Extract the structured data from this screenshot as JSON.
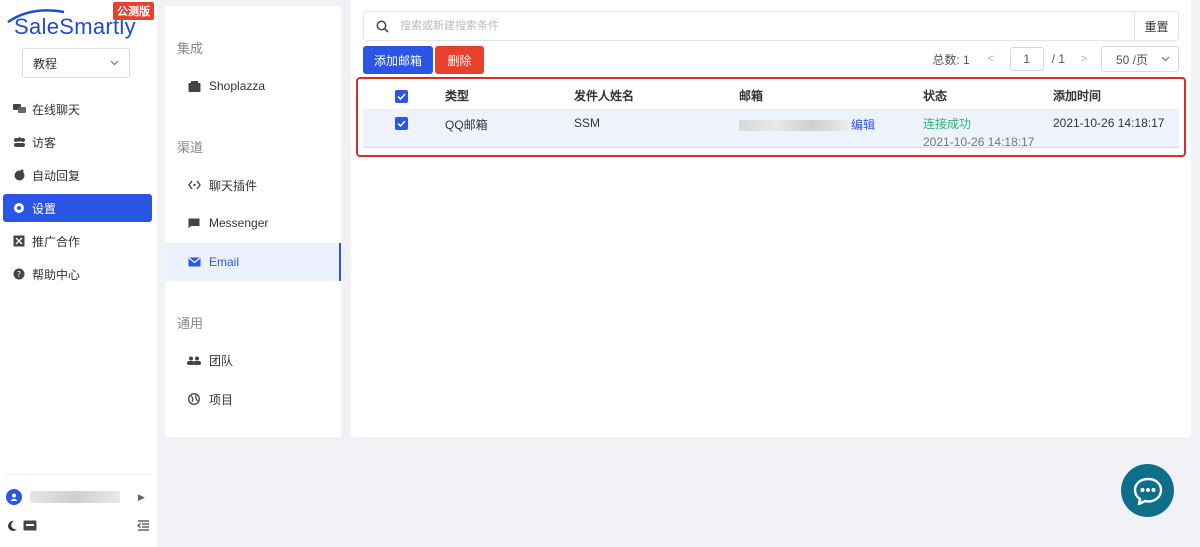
{
  "brand": {
    "name": "SaleSmartly",
    "badge": "公测版",
    "color": "#1f4bd1"
  },
  "project_select": {
    "value": "教程"
  },
  "nav": {
    "items": [
      {
        "label": "在线聊天",
        "icon": "chat-icon"
      },
      {
        "label": "访客",
        "icon": "visitors-icon"
      },
      {
        "label": "自动回复",
        "icon": "robot-icon"
      },
      {
        "label": "设置",
        "icon": "settings-icon",
        "active": true
      },
      {
        "label": "推广合作",
        "icon": "partner-icon"
      },
      {
        "label": "帮助中心",
        "icon": "help-icon"
      }
    ]
  },
  "settings_menu": {
    "sections": [
      {
        "title": "集成",
        "items": [
          {
            "label": "Shoplazza",
            "icon": "store-icon"
          }
        ]
      },
      {
        "title": "渠道",
        "items": [
          {
            "label": "聊天插件",
            "icon": "code-icon"
          },
          {
            "label": "Messenger",
            "icon": "message-icon"
          },
          {
            "label": "Email",
            "icon": "mail-icon",
            "active": true
          }
        ]
      },
      {
        "title": "通用",
        "items": [
          {
            "label": "团队",
            "icon": "team-icon"
          },
          {
            "label": "项目",
            "icon": "globe-icon"
          }
        ]
      }
    ]
  },
  "search": {
    "placeholder": "搜索或新建搜索条件",
    "reset_label": "重置"
  },
  "toolbar": {
    "add_label": "添加邮箱",
    "delete_label": "删除"
  },
  "pagination": {
    "total_label": "总数: 1",
    "current_page": "1",
    "page_count": "/ 1",
    "page_size": "50 /页"
  },
  "table": {
    "columns": [
      "类型",
      "发件人姓名",
      "邮箱",
      "状态",
      "添加时间"
    ],
    "rows": [
      {
        "type": "QQ邮箱",
        "sender": "SSM",
        "email_action": "编辑",
        "status": "连接成功",
        "status_time": "2021-10-26 14:18:17",
        "added": "2021-10-26 14:18:17"
      }
    ]
  },
  "colors": {
    "primary": "#2a55e5",
    "danger": "#e8412b",
    "success": "#32b36b",
    "fab": "#0d6f8a"
  }
}
